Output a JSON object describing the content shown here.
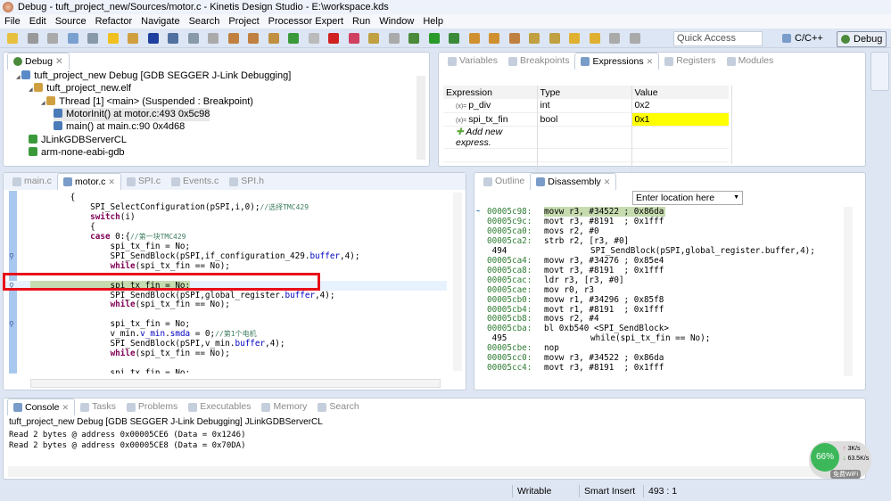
{
  "window": {
    "title": "Debug - tuft_project_new/Sources/motor.c - Kinetis Design Studio - E:\\workspace.kds"
  },
  "menu": [
    "File",
    "Edit",
    "Source",
    "Refactor",
    "Navigate",
    "Search",
    "Project",
    "Processor Expert",
    "Run",
    "Window",
    "Help"
  ],
  "toolbar": {
    "quick_access_placeholder": "Quick Access",
    "perspectives": [
      "C/C++",
      "Debug"
    ]
  },
  "debug_view": {
    "tab": "Debug",
    "items": [
      {
        "label": "tuft_project_new Debug [GDB SEGGER J-Link Debugging]",
        "level": 0,
        "icon": "launch-icon"
      },
      {
        "label": "tuft_project_new.elf",
        "level": 1,
        "icon": "process-icon"
      },
      {
        "label": "Thread [1] <main> (Suspended : Breakpoint)",
        "level": 2,
        "icon": "thread-icon"
      },
      {
        "label": "MotorInit() at motor.c:493 0x5c98",
        "level": 3,
        "icon": "stack-frame-icon",
        "selected": true
      },
      {
        "label": "main() at main.c:90 0x4d68",
        "level": 3,
        "icon": "stack-frame-icon"
      },
      {
        "label": "JLinkGDBServerCL",
        "level": 1,
        "icon": "server-icon"
      },
      {
        "label": "arm-none-eabi-gdb",
        "level": 1,
        "icon": "server-icon"
      }
    ]
  },
  "expressions_view": {
    "tabs": [
      "Variables",
      "Breakpoints",
      "Expressions",
      "Registers",
      "Modules"
    ],
    "active": "Expressions",
    "columns": [
      "Expression",
      "Type",
      "Value"
    ],
    "rows": [
      {
        "name": "p_div",
        "type": "int",
        "value": "0x2",
        "changed": false
      },
      {
        "name": "spi_tx_fin",
        "type": "bool",
        "value": "0x1",
        "changed": true
      }
    ],
    "add_label": "Add new express.",
    "changed_color": "#ffff00"
  },
  "editor": {
    "tabs": [
      "main.c",
      "motor.c",
      "SPI.c",
      "Events.c",
      "SPI.h"
    ],
    "active": "motor.c",
    "lines": [
      [
        [
          "        {",
          ""
        ]
      ],
      [
        [
          "            SPI_SelectConfiguration(pSPI,i,0);",
          ""
        ],
        [
          "//选择TMC429",
          "cm"
        ]
      ],
      [
        [
          "            ",
          ""
        ],
        [
          "switch",
          "kw"
        ],
        [
          "(i)",
          ""
        ]
      ],
      [
        [
          "            {",
          ""
        ]
      ],
      [
        [
          "            ",
          ""
        ],
        [
          "case",
          "kw"
        ],
        [
          " 0:{",
          ""
        ],
        [
          "//第一块TMC429",
          "cm"
        ]
      ],
      [
        [
          "                spi_tx_fin = No;",
          ""
        ]
      ],
      [
        [
          "                SPI_SendBlock(pSPI,if_configuration_429.",
          ""
        ],
        [
          "buffer",
          "fld"
        ],
        [
          ",4);",
          ""
        ]
      ],
      [
        [
          "                ",
          ""
        ],
        [
          "while",
          "kw"
        ],
        [
          "(spi_tx_fin == No);",
          ""
        ]
      ],
      [
        [
          "",
          ""
        ]
      ],
      [
        [
          "                spi tx fin = No;",
          ""
        ]
      ],
      [
        [
          "                SPI_SendBlock(pSPI,global_register.",
          ""
        ],
        [
          "buffer",
          "fld"
        ],
        [
          ",4);",
          ""
        ]
      ],
      [
        [
          "                ",
          ""
        ],
        [
          "while",
          "kw"
        ],
        [
          "(spi_tx_fin == No);",
          ""
        ]
      ],
      [
        [
          "",
          ""
        ]
      ],
      [
        [
          "                spi_tx_fin = No;",
          ""
        ]
      ],
      [
        [
          "                v_min.",
          ""
        ],
        [
          "v_min",
          "fld"
        ],
        [
          ".",
          ""
        ],
        [
          "smda",
          "fld"
        ],
        [
          " = 0;",
          ""
        ],
        [
          "//第1个电机",
          "cm"
        ]
      ],
      [
        [
          "                SPI_SendBlock(pSPI,v_min.",
          ""
        ],
        [
          "buffer",
          "fld"
        ],
        [
          ",4);",
          ""
        ]
      ],
      [
        [
          "                ",
          ""
        ],
        [
          "while",
          "kw"
        ],
        [
          "(spi_tx_fin == No);",
          ""
        ]
      ],
      [
        [
          "",
          ""
        ]
      ],
      [
        [
          "                spi_tx_fin = No;",
          ""
        ]
      ]
    ],
    "current_line_index": 9,
    "breakpoint_lines": [
      6,
      9,
      13
    ]
  },
  "disassembly": {
    "tabs": [
      "Outline",
      "Disassembly"
    ],
    "active": "Disassembly",
    "location_placeholder": "Enter location here",
    "lines": [
      {
        "a": "00005c98:",
        "i": "movw r3, #34522 ; 0x86da",
        "current": true
      },
      {
        "a": "00005c9c:",
        "i": "movt r3, #8191  ; 0x1fff"
      },
      {
        "a": "00005ca0:",
        "i": "movs r2, #0"
      },
      {
        "a": "00005ca2:",
        "i": "strb r2, [r3, #0]"
      },
      {
        "a": " 494",
        "src": "SPI_SendBlock(pSPI,global_register.buffer,4);"
      },
      {
        "a": "00005ca4:",
        "i": "movw r3, #34276 ; 0x85e4"
      },
      {
        "a": "00005ca8:",
        "i": "movt r3, #8191  ; 0x1fff"
      },
      {
        "a": "00005cac:",
        "i": "ldr r3, [r3, #0]"
      },
      {
        "a": "00005cae:",
        "i": "mov r0, r3"
      },
      {
        "a": "00005cb0:",
        "i": "movw r1, #34296 ; 0x85f8"
      },
      {
        "a": "00005cb4:",
        "i": "movt r1, #8191  ; 0x1fff"
      },
      {
        "a": "00005cb8:",
        "i": "movs r2, #4"
      },
      {
        "a": "00005cba:",
        "i": "bl 0xb540 <SPI_SendBlock>"
      },
      {
        "a": " 495",
        "src": "while(spi_tx_fin == No);"
      },
      {
        "a": "00005cbe:",
        "i": "nop"
      },
      {
        "a": "00005cc0:",
        "i": "movw r3, #34522 ; 0x86da"
      },
      {
        "a": "00005cc4:",
        "i": "movt r3, #8191  ; 0x1fff"
      }
    ]
  },
  "console": {
    "tabs": [
      "Console",
      "Tasks",
      "Problems",
      "Executables",
      "Memory",
      "Search"
    ],
    "active": "Console",
    "header": "tuft_project_new Debug [GDB SEGGER J-Link Debugging] JLinkGDBServerCL",
    "lines": [
      "Read 2 bytes @ address 0x00005CE6 (Data = 0x1246)",
      "Read 2 bytes @ address 0x00005CE8 (Data = 0x70DA)"
    ]
  },
  "net_widget": {
    "percent": "66%",
    "up": "3K/s",
    "down": "63.5K/s",
    "label": "免费WiFi"
  },
  "status": {
    "writable": "Writable",
    "insert_mode": "Smart Insert",
    "position": "493 : 1"
  }
}
